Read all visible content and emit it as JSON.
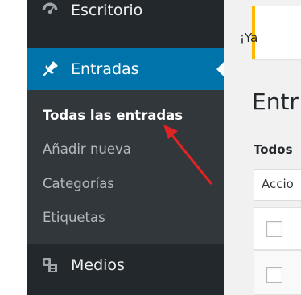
{
  "sidebar": {
    "escritorio": {
      "label": "Escritorio",
      "icon": "dashboard-icon"
    },
    "entradas": {
      "label": "Entradas",
      "icon": "pushpin-icon",
      "state": "current"
    },
    "submenu": [
      {
        "label": "Todas las entradas",
        "current": true
      },
      {
        "label": "Añadir nueva"
      },
      {
        "label": "Categorías"
      },
      {
        "label": "Etiquetas"
      }
    ],
    "medios": {
      "label": "Medios",
      "icon": "media-icon"
    }
  },
  "content": {
    "notice_text": "¡Ya",
    "page_title": "Entr",
    "filter_label": "Todos",
    "bulk_actions_value": "Accio"
  },
  "annotation": {
    "type": "arrow",
    "color": "#e02424",
    "points_to": "Todas las entradas"
  },
  "colors": {
    "sidebar_bg": "#23282d",
    "submenu_bg": "#32373c",
    "active_bg": "#0073aa",
    "notice_border": "#ffb900",
    "content_bg": "#f1f1f1"
  }
}
